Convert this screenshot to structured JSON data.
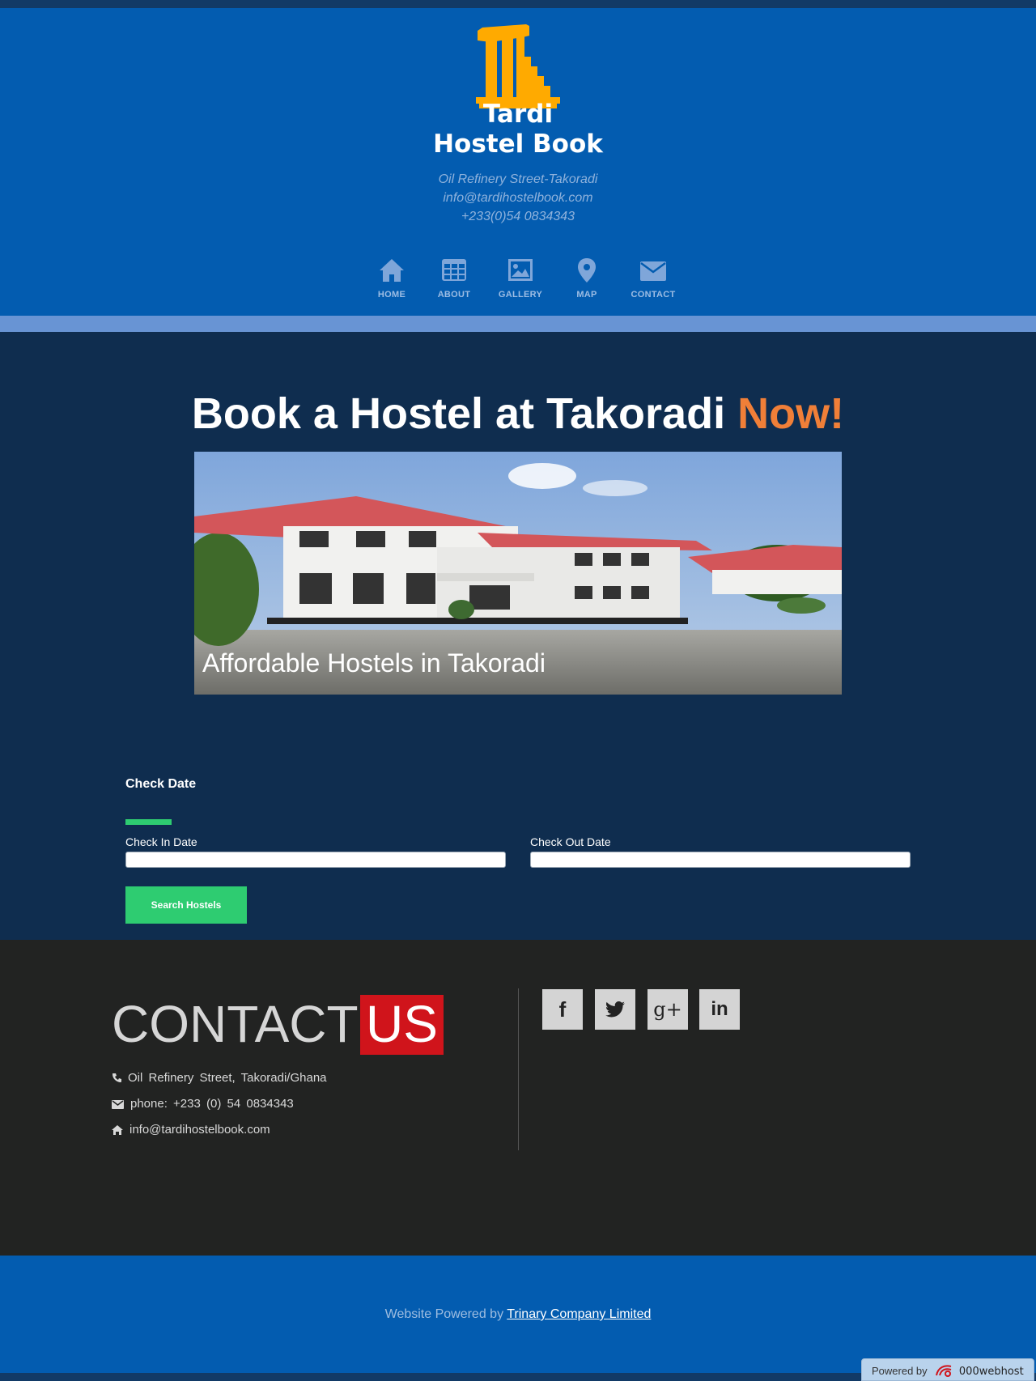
{
  "header": {
    "brand_line1": "Tardi",
    "brand_line2": "Hostel Book",
    "address": "Oil Refinery Street-Takoradi",
    "email": "info@tardihostelbook.com",
    "phone": "+233(0)54 0834343",
    "logo_color": "#ffaa00",
    "background": "#035cb0"
  },
  "nav": {
    "items": [
      {
        "label": "HOME",
        "icon": "home-icon"
      },
      {
        "label": "ABOUT",
        "icon": "grid-icon"
      },
      {
        "label": "GALLERY",
        "icon": "image-icon"
      },
      {
        "label": "MAP",
        "icon": "map-pin-icon"
      },
      {
        "label": "CONTACT",
        "icon": "envelope-icon"
      }
    ]
  },
  "hero": {
    "headline": "Book a Hostel at Takoradi",
    "headline_accent": "Now!",
    "accent_color": "#f07f38",
    "caption": "Affordable Hostels in Takoradi"
  },
  "booking": {
    "title": "Check Date",
    "check_in_label": "Check In Date",
    "check_in_value": "",
    "check_out_label": "Check Out Date",
    "check_out_value": "",
    "search_label": "Search Hostels",
    "button_color": "#2ecc71"
  },
  "contact": {
    "title": "CONTACT",
    "title_highlight": "US",
    "highlight_color": "#d0141b",
    "address": "Oil Refinery Street, Takoradi/Ghana",
    "phone": "phone: +233 (0) 54 0834343",
    "email": "info@tardihostelbook.com",
    "social": [
      {
        "icon": "facebook-icon",
        "glyph": "f"
      },
      {
        "icon": "twitter-icon",
        "glyph": ""
      },
      {
        "icon": "google-plus-icon",
        "glyph": "g+"
      },
      {
        "icon": "linkedin-icon",
        "glyph": "in"
      }
    ]
  },
  "footer": {
    "text": "Website Powered by",
    "link": "Trinary Company Limited",
    "badge_prefix": "Powered by",
    "badge_brand": "000webhost"
  }
}
